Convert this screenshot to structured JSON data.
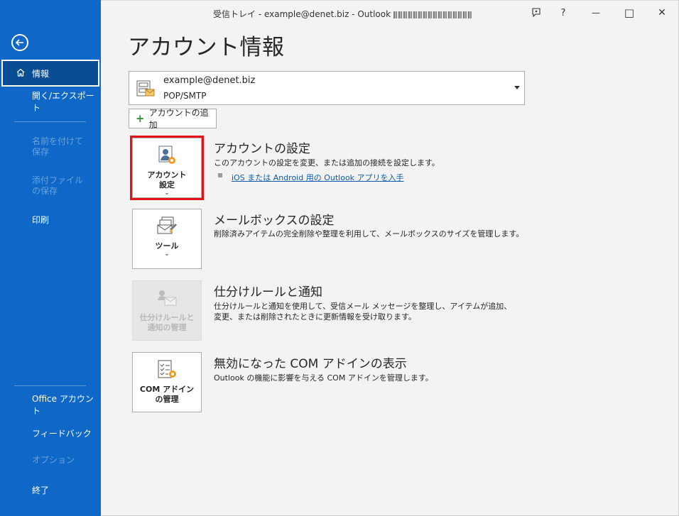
{
  "window": {
    "title": "受信トレイ - example@denet.biz  -  Outlook",
    "buttons": {
      "feedback": "feedback-icon",
      "help": "?",
      "minimize": "—",
      "maximize": "□",
      "close": "✕"
    }
  },
  "sidebar": {
    "items": [
      {
        "label": "情報",
        "state": "active"
      },
      {
        "label": "開く/エクスポート",
        "state": "normal"
      },
      {
        "label": "名前を付けて保存",
        "state": "disabled"
      },
      {
        "label": "添付ファイルの保存",
        "state": "disabled"
      },
      {
        "label": "印刷",
        "state": "normal"
      },
      {
        "label": "Office アカウント",
        "state": "normal"
      },
      {
        "label": "フィードバック",
        "state": "normal"
      },
      {
        "label": "オプション",
        "state": "disabled"
      },
      {
        "label": "終了",
        "state": "normal"
      }
    ]
  },
  "main": {
    "title": "アカウント情報",
    "account": {
      "email": "example@denet.biz",
      "type": "POP/SMTP"
    },
    "add_account": "アカウントの追加",
    "sections": [
      {
        "tile_label_1": "アカウント",
        "tile_label_2": "設定",
        "title": "アカウントの設定",
        "desc": "このアカウントの設定を変更、または追加の接続を設定します。",
        "link": "iOS または Android 用の Outlook アプリを入手"
      },
      {
        "tile_label_1": "ツール",
        "title": "メールボックスの設定",
        "desc": "削除済みアイテムの完全削除や整理を利用して、メールボックスのサイズを管理します。"
      },
      {
        "tile_label_1": "仕分けルールと",
        "tile_label_2": "通知の管理",
        "title": "仕分けルールと通知",
        "desc": "仕分けルールと通知を使用して、受信メール メッセージを整理し、アイテムが追加、変更、または削除されたときに更新情報を受け取ります。"
      },
      {
        "tile_label_1": "COM アドイン",
        "tile_label_2": "の管理",
        "title": "無効になった COM アドインの表示",
        "desc": "Outlook の機能に影響を与える COM アドインを管理します。"
      }
    ]
  },
  "colors": {
    "sidebar": "#0f68c7",
    "highlight": "#e11419",
    "link": "#0b5cad"
  }
}
